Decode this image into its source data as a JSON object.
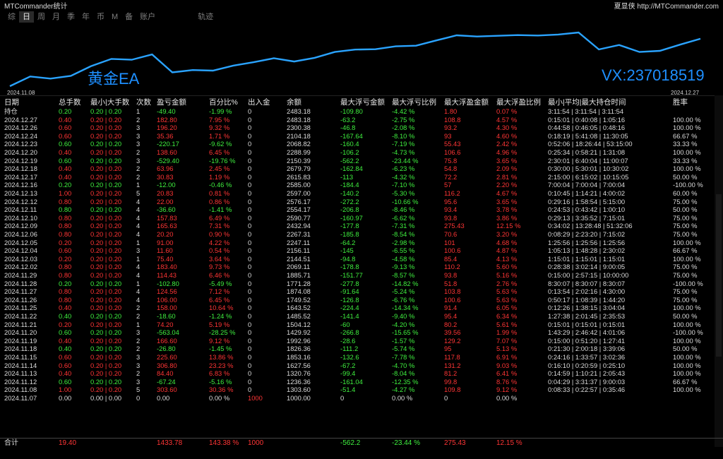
{
  "app_title": "MTCommander统计",
  "brand": "夏显侠 http://MTCommander.com",
  "tabs": [
    "综",
    "日",
    "周",
    "月",
    "季",
    "年",
    "币",
    "M",
    "备",
    "账户",
    "轨迹"
  ],
  "active_tab": 1,
  "chart": {
    "ea_label": "黄金EA",
    "vx_label": "VX:237018519",
    "date_start": "2024.11.08",
    "date_end": "2024.12.27",
    "line_color": "#2aa3ff",
    "balance_series": [
      1000.0,
      1303.6,
      1236.36,
      1320.76,
      1627.56,
      1853.16,
      1826.36,
      1992.96,
      1429.92,
      1504.12,
      1485.52,
      1643.52,
      1749.52,
      1874.08,
      1771.28,
      1885.71,
      2069.11,
      2144.51,
      2156.11,
      2247.11,
      2267.31,
      2432.94,
      2590.77,
      2554.17,
      2576.17,
      2597.0,
      2585.0,
      2615.83,
      2679.79,
      2150.39,
      2288.99,
      2068.82,
      2104.18,
      2300.38,
      2483.18
    ]
  },
  "table": {
    "headers": [
      "日期",
      "总手数",
      "最小|大手数",
      "次数",
      "盈亏金额",
      "百分比%",
      "出入金",
      "余额",
      "最大浮亏金额",
      "最大浮亏比例",
      "最大浮盈金额",
      "最大浮盈比例",
      "最小|平均|最大持仓时间",
      "胜率"
    ],
    "rows": [
      {
        "c": "g",
        "v": [
          "持仓",
          "0.20",
          "0.20 | 0.20",
          "1",
          "-49.40",
          "-1.99 %",
          "0",
          "2483.18",
          "-109.80",
          "-4.42 %",
          "1.80",
          "0.07 %",
          "3:11:54 | 3:11:54 | 3:11:54",
          ""
        ]
      },
      {
        "c": "r",
        "v": [
          "2024.12.27",
          "0.40",
          "0.20 | 0.20",
          "2",
          "182.80",
          "7.95 %",
          "0",
          "2483.18",
          "-63.2",
          "-2.75 %",
          "108.8",
          "4.57 %",
          "0:15:01 | 0:40:08 | 1:05:16",
          "100.00 %"
        ]
      },
      {
        "c": "r",
        "v": [
          "2024.12.26",
          "0.60",
          "0.20 | 0.20",
          "3",
          "196.20",
          "9.32 %",
          "0",
          "2300.38",
          "-46.8",
          "-2.08 %",
          "93.2",
          "4.30 %",
          "0:44:58 | 0:46:05 | 0:48:16",
          "100.00 %"
        ]
      },
      {
        "c": "r",
        "v": [
          "2024.12.24",
          "0.60",
          "0.20 | 0.20",
          "3",
          "35.36",
          "1.71 %",
          "0",
          "2104.18",
          "-167.64",
          "-8.10 %",
          "93",
          "4.60 %",
          "0:18:19 | 5:41:08 | 11:30:05",
          "66.67 %"
        ]
      },
      {
        "c": "g",
        "v": [
          "2024.12.23",
          "0.60",
          "0.20 | 0.20",
          "3",
          "-220.17",
          "-9.62 %",
          "0",
          "2068.82",
          "-160.4",
          "-7.19 %",
          "55.43",
          "2.42 %",
          "0:52:06 | 18:26:44 | 53:15:00",
          "33.33 %"
        ]
      },
      {
        "c": "r",
        "v": [
          "2024.12.20",
          "0.40",
          "0.20 | 0.20",
          "2",
          "138.60",
          "6.45 %",
          "0",
          "2288.99",
          "-106.2",
          "-4.73 %",
          "106.6",
          "4.96 %",
          "0:25:34 | 0:58:21 | 1:31:08",
          "100.00 %"
        ]
      },
      {
        "c": "g",
        "v": [
          "2024.12.19",
          "0.60",
          "0.20 | 0.20",
          "3",
          "-529.40",
          "-19.76 %",
          "0",
          "2150.39",
          "-562.2",
          "-23.44 %",
          "75.8",
          "3.65 %",
          "2:30:01 | 6:40:04 | 11:00:07",
          "33.33 %"
        ]
      },
      {
        "c": "r",
        "v": [
          "2024.12.18",
          "0.40",
          "0.20 | 0.20",
          "2",
          "63.96",
          "2.45 %",
          "0",
          "2679.79",
          "-162.84",
          "-6.23 %",
          "54.8",
          "2.09 %",
          "0:30:00 | 5:30:01 | 10:30:02",
          "100.00 %"
        ]
      },
      {
        "c": "r",
        "v": [
          "2024.12.17",
          "0.40",
          "0.20 | 0.20",
          "2",
          "30.83",
          "1.19 %",
          "0",
          "2615.83",
          "-113",
          "-4.32 %",
          "72.2",
          "2.81 %",
          "2:15:00 | 6:15:02 | 10:15:05",
          "50.00 %"
        ]
      },
      {
        "c": "g",
        "v": [
          "2024.12.16",
          "0.20",
          "0.20 | 0.20",
          "1",
          "-12.00",
          "-0.46 %",
          "0",
          "2585.00",
          "-184.4",
          "-7.10 %",
          "57",
          "2.20 %",
          "7:00:04 | 7:00:04 | 7:00:04",
          "-100.00 %"
        ]
      },
      {
        "c": "r",
        "v": [
          "2024.12.13",
          "1.00",
          "0.20 | 0.20",
          "5",
          "20.83",
          "0.81 %",
          "0",
          "2597.00",
          "-140.2",
          "-5.30 %",
          "116.2",
          "4.67 %",
          "0:10:45 | 1:14:21 | 4:00:02",
          "60.00 %"
        ]
      },
      {
        "c": "r",
        "v": [
          "2024.12.12",
          "0.80",
          "0.20 | 0.20",
          "4",
          "22.00",
          "0.86 %",
          "0",
          "2576.17",
          "-272.2",
          "-10.66 %",
          "95.6",
          "3.65 %",
          "0:29:16 | 1:58:54 | 5:15:00",
          "75.00 %"
        ]
      },
      {
        "c": "g",
        "v": [
          "2024.12.11",
          "0.80",
          "0.20 | 0.20",
          "4",
          "-36.60",
          "-1.41 %",
          "0",
          "2554.17",
          "-206.8",
          "-8.46 %",
          "93.4",
          "3.78 %",
          "0:24:53 | 0:43:42 | 1:00:10",
          "50.00 %"
        ]
      },
      {
        "c": "r",
        "v": [
          "2024.12.10",
          "0.80",
          "0.20 | 0.20",
          "4",
          "157.83",
          "6.49 %",
          "0",
          "2590.77",
          "-160.97",
          "-6.62 %",
          "93.8",
          "3.86 %",
          "0:29:13 | 3:35:52 | 7:15:01",
          "75.00 %"
        ]
      },
      {
        "c": "r",
        "v": [
          "2024.12.09",
          "0.80",
          "0.20 | 0.20",
          "4",
          "165.63",
          "7.31 %",
          "0",
          "2432.94",
          "-177.8",
          "-7.31 %",
          "275.43",
          "12.15 %",
          "0:34:02 | 13:28:48 | 51:32:06",
          "75.00 %"
        ]
      },
      {
        "c": "r",
        "v": [
          "2024.12.06",
          "0.80",
          "0.20 | 0.20",
          "4",
          "20.20",
          "0.90 %",
          "0",
          "2267.31",
          "-185.8",
          "-8.54 %",
          "70.6",
          "3.20 %",
          "0:08:29 | 2:23:20 | 7:15:02",
          "75.00 %"
        ]
      },
      {
        "c": "r",
        "v": [
          "2024.12.05",
          "0.20",
          "0.20 | 0.20",
          "1",
          "91.00",
          "4.22 %",
          "0",
          "2247.11",
          "-64.2",
          "-2.98 %",
          "101",
          "4.68 %",
          "1:25:56 | 1:25:56 | 1:25:56",
          "100.00 %"
        ]
      },
      {
        "c": "r",
        "v": [
          "2024.12.04",
          "0.60",
          "0.20 | 0.20",
          "3",
          "11.60",
          "0.54 %",
          "0",
          "2156.11",
          "-145",
          "-6.55 %",
          "100.6",
          "4.87 %",
          "1:05:13 | 1:48:28 | 2:30:02",
          "66.67 %"
        ]
      },
      {
        "c": "r",
        "v": [
          "2024.12.03",
          "0.20",
          "0.20 | 0.20",
          "1",
          "75.40",
          "3.64 %",
          "0",
          "2144.51",
          "-94.8",
          "-4.58 %",
          "85.4",
          "4.13 %",
          "1:15:01 | 1:15:01 | 1:15:01",
          "100.00 %"
        ]
      },
      {
        "c": "r",
        "v": [
          "2024.12.02",
          "0.80",
          "0.20 | 0.20",
          "4",
          "183.40",
          "9.73 %",
          "0",
          "2069.11",
          "-178.8",
          "-9.13 %",
          "110.2",
          "5.60 %",
          "0:28:38 | 3:02:14 | 9:00:05",
          "75.00 %"
        ]
      },
      {
        "c": "r",
        "v": [
          "2024.11.29",
          "0.80",
          "0.20 | 0.20",
          "4",
          "114.43",
          "6.46 %",
          "0",
          "1885.71",
          "-151.77",
          "-8.57 %",
          "93.8",
          "5.16 %",
          "0:15:00 | 2:57:15 | 10:00:00",
          "75.00 %"
        ]
      },
      {
        "c": "g",
        "v": [
          "2024.11.28",
          "0.20",
          "0.20 | 0.20",
          "1",
          "-102.80",
          "-5.49 %",
          "0",
          "1771.28",
          "-277.8",
          "-14.82 %",
          "51.8",
          "2.76 %",
          "8:30:07 | 8:30:07 | 8:30:07",
          "-100.00 %"
        ]
      },
      {
        "c": "r",
        "v": [
          "2024.11.27",
          "0.80",
          "0.20 | 0.20",
          "4",
          "124.56",
          "7.12 %",
          "0",
          "1874.08",
          "-91.64",
          "-5.24 %",
          "103.8",
          "5.63 %",
          "0:13:54 | 2:02:16 | 4:30:00",
          "75.00 %"
        ]
      },
      {
        "c": "r",
        "v": [
          "2024.11.26",
          "0.80",
          "0.20 | 0.20",
          "4",
          "106.00",
          "6.45 %",
          "0",
          "1749.52",
          "-126.8",
          "-6.76 %",
          "100.6",
          "5.63 %",
          "0:50:17 | 1:08:39 | 1:44:20",
          "75.00 %"
        ]
      },
      {
        "c": "r",
        "v": [
          "2024.11.25",
          "0.40",
          "0.20 | 0.20",
          "2",
          "158.00",
          "10.64 %",
          "0",
          "1643.52",
          "-224.4",
          "-14.34 %",
          "91.4",
          "6.05 %",
          "0:12:26 | 1:38:15 | 3:04:04",
          "100.00 %"
        ]
      },
      {
        "c": "g",
        "v": [
          "2024.11.22",
          "0.40",
          "0.20 | 0.20",
          "2",
          "-18.60",
          "-1.24 %",
          "0",
          "1485.52",
          "-141.4",
          "-9.40 %",
          "95.4",
          "6.34 %",
          "1:27:38 | 2:01:45 | 2:35:53",
          "50.00 %"
        ]
      },
      {
        "c": "r",
        "v": [
          "2024.11.21",
          "0.20",
          "0.20 | 0.20",
          "1",
          "74.20",
          "5.19 %",
          "0",
          "1504.12",
          "-60",
          "-4.20 %",
          "80.2",
          "5.61 %",
          "0:15:01 | 0:15:01 | 0:15:01",
          "100.00 %"
        ]
      },
      {
        "c": "g",
        "v": [
          "2024.11.20",
          "0.60",
          "0.20 | 0.20",
          "3",
          "-563.04",
          "-28.25 %",
          "0",
          "1429.92",
          "-266.8",
          "-15.65 %",
          "39.56",
          "1.99 %",
          "1:43:29 | 2:46:42 | 4:01:06",
          "-100.00 %"
        ]
      },
      {
        "c": "r",
        "v": [
          "2024.11.19",
          "0.40",
          "0.20 | 0.20",
          "2",
          "166.60",
          "9.12 %",
          "0",
          "1992.96",
          "-28.6",
          "-1.57 %",
          "129.2",
          "7.07 %",
          "0:15:00 | 0:51:20 | 1:27:41",
          "100.00 %"
        ]
      },
      {
        "c": "g",
        "v": [
          "2024.11.18",
          "0.40",
          "0.20 | 0.20",
          "2",
          "-26.80",
          "-1.45 %",
          "0",
          "1826.36",
          "-111.2",
          "-5.74 %",
          "95",
          "5.13 %",
          "0:21:30 | 2:00:18 | 3:39:06",
          "50.00 %"
        ]
      },
      {
        "c": "r",
        "v": [
          "2024.11.15",
          "0.60",
          "0.20 | 0.20",
          "3",
          "225.60",
          "13.86 %",
          "0",
          "1853.16",
          "-132.6",
          "-7.78 %",
          "117.8",
          "6.91 %",
          "0:24:16 | 1:33:57 | 3:02:36",
          "100.00 %"
        ]
      },
      {
        "c": "r",
        "v": [
          "2024.11.14",
          "0.60",
          "0.20 | 0.20",
          "3",
          "306.80",
          "23.23 %",
          "0",
          "1627.56",
          "-67.2",
          "-4.70 %",
          "131.2",
          "9.03 %",
          "0:16:10 | 0:20:59 | 0:25:10",
          "100.00 %"
        ]
      },
      {
        "c": "r",
        "v": [
          "2024.11.13",
          "0.40",
          "0.20 | 0.20",
          "2",
          "84.40",
          "6.83 %",
          "0",
          "1320.76",
          "-99.4",
          "-8.04 %",
          "81.2",
          "6.41 %",
          "0:14:59 | 1:10:21 | 2:05:43",
          "100.00 %"
        ]
      },
      {
        "c": "g",
        "v": [
          "2024.11.12",
          "0.60",
          "0.20 | 0.20",
          "3",
          "-67.24",
          "-5.16 %",
          "0",
          "1236.36",
          "-161.04",
          "-12.35 %",
          "99.8",
          "8.76 %",
          "0:04:29 | 3:31:37 | 9:00:03",
          "66.67 %"
        ]
      },
      {
        "c": "r",
        "v": [
          "2024.11.08",
          "1.00",
          "0.20 | 0.20",
          "5",
          "303.60",
          "30.36 %",
          "0",
          "1303.60",
          "-51.4",
          "-4.27 %",
          "109.8",
          "9.12 %",
          "0:08:33 | 0:22:57 | 0:35:46",
          "100.00 %"
        ]
      },
      {
        "c": "w",
        "v": [
          "2024.11.07",
          "0.00",
          "0.00 | 0.00",
          "0",
          "0.00",
          "0.00 %",
          "1000",
          "1000.00",
          "0",
          "0.00 %",
          "0",
          "0.00 %",
          "",
          ""
        ]
      }
    ],
    "total": {
      "label": "合计",
      "lots": "19.40",
      "pnl": "1433.78",
      "pct": "143.38 %",
      "deposit": "1000",
      "max_dd": "-562.2",
      "max_dd_pct": "-23.44 %",
      "max_fp": "275.43",
      "max_fp_pct": "12.15 %"
    }
  }
}
